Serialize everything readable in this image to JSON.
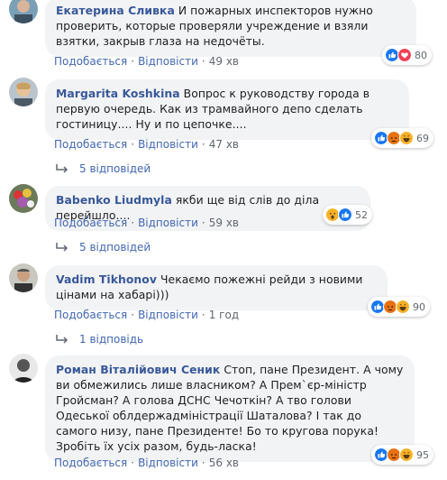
{
  "actions": {
    "like": "Подобається",
    "reply": "Відповісти",
    "sep": "·"
  },
  "comments": [
    {
      "author": "Екатерина Сливка",
      "text": "И пожарных инспекторов нужно проверить, которые проверяли учреждение и взяли взятки, закрыв глаза на недочёты.",
      "time": "49 хв",
      "reactions": [
        "like",
        "love"
      ],
      "count": "80"
    },
    {
      "author": "Margarita Koshkina",
      "text": "Вопрос к руководству города в первую очередь. Как из трамвайного депо сделать гостиницу.... Ну и по цепочке....",
      "time": "47 хв",
      "reactions": [
        "like",
        "angry",
        "haha"
      ],
      "count": "69",
      "replies": "5 відповідей"
    },
    {
      "author": "Babenko Liudmyla",
      "text": "якби ще від слів до діла перейшло....",
      "time": "59 хв",
      "reactions": [
        "wow",
        "like"
      ],
      "count": "52",
      "replies": "5 відповідей"
    },
    {
      "author": "Vadim Tikhonov",
      "text": "Чекаємо пожежні рейди з новими цінами на хабарі)))",
      "time": "1 год",
      "reactions": [
        "like",
        "angry",
        "haha"
      ],
      "count": "90",
      "replies": "1 відповідь"
    },
    {
      "author": "Роман Віталійович Сеник",
      "text": "Стоп, пане Президент. А чому ви обмежились лише власником? А Прем`єр-міністр Гройсман? А голова ДСНС Чечоткін? А тво голови Одеської облдержадміністрації Шаталова? І так до самого низу, пане Президенте! Бо то кругова порука! Зробіть їх усіх разом, будь-ласка!",
      "time": "56 хв",
      "reactions": [
        "like",
        "angry",
        "haha"
      ],
      "count": "95"
    }
  ],
  "colors": {
    "author": "#385898",
    "link": "#4267b2",
    "bubble": "#f2f3f5"
  }
}
